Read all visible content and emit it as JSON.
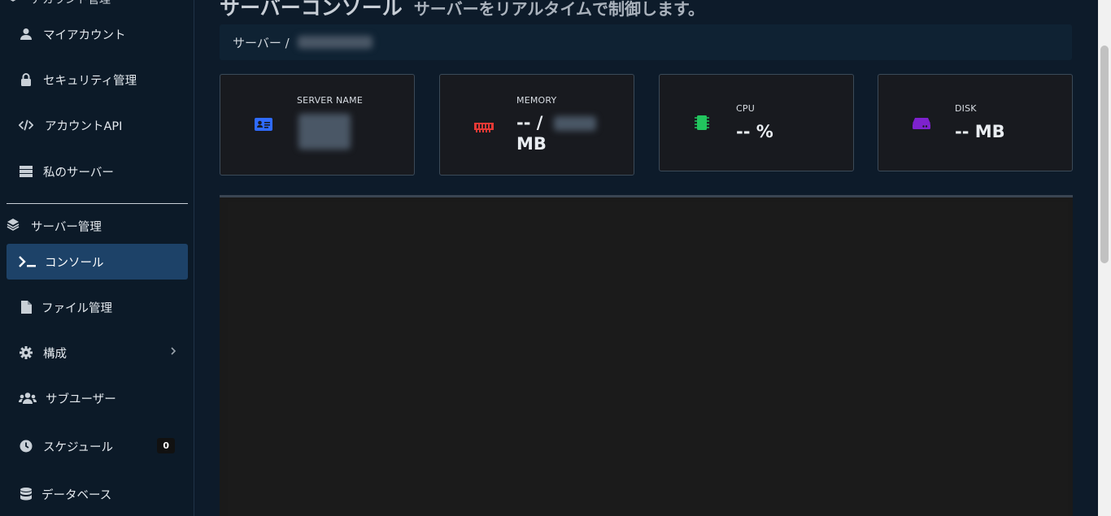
{
  "sidebar": {
    "account_header": "アカウント管理",
    "account_items": [
      {
        "label": "マイアカウント",
        "icon": "user-icon"
      },
      {
        "label": "セキュリティ管理",
        "icon": "lock-icon"
      },
      {
        "label": "アカウントAPI",
        "icon": "code-icon"
      },
      {
        "label": "私のサーバー",
        "icon": "server-icon"
      }
    ],
    "server_section": "サーバー管理",
    "server_items": [
      {
        "label": "コンソール",
        "icon": "terminal-icon",
        "active": true
      },
      {
        "label": "ファイル管理",
        "icon": "file-icon"
      },
      {
        "label": "構成",
        "icon": "gear-icon"
      },
      {
        "label": "サブユーザー",
        "icon": "users-icon"
      },
      {
        "label": "スケジュール",
        "icon": "clock-icon",
        "badge": "0"
      },
      {
        "label": "データベース",
        "icon": "database-icon"
      }
    ]
  },
  "header": {
    "title": "サーバーコンソール",
    "subtitle": "サーバーをリアルタイムで制御します。"
  },
  "breadcrumb": {
    "root": "サーバー /"
  },
  "stats": {
    "server_name": {
      "label": "SERVER NAME",
      "icon_color": "#2f6bff"
    },
    "memory": {
      "label": "MEMORY",
      "value_prefix": "-- /",
      "unit": "MB",
      "icon_color": "#e53935"
    },
    "cpu": {
      "label": "CPU",
      "value": "-- %",
      "icon_color": "#22c55e"
    },
    "disk": {
      "label": "DISK",
      "value": "-- MB",
      "icon_color": "#7e22ce"
    }
  },
  "colors": {
    "accent": "#1d4268",
    "background": "#0d1b2a"
  }
}
